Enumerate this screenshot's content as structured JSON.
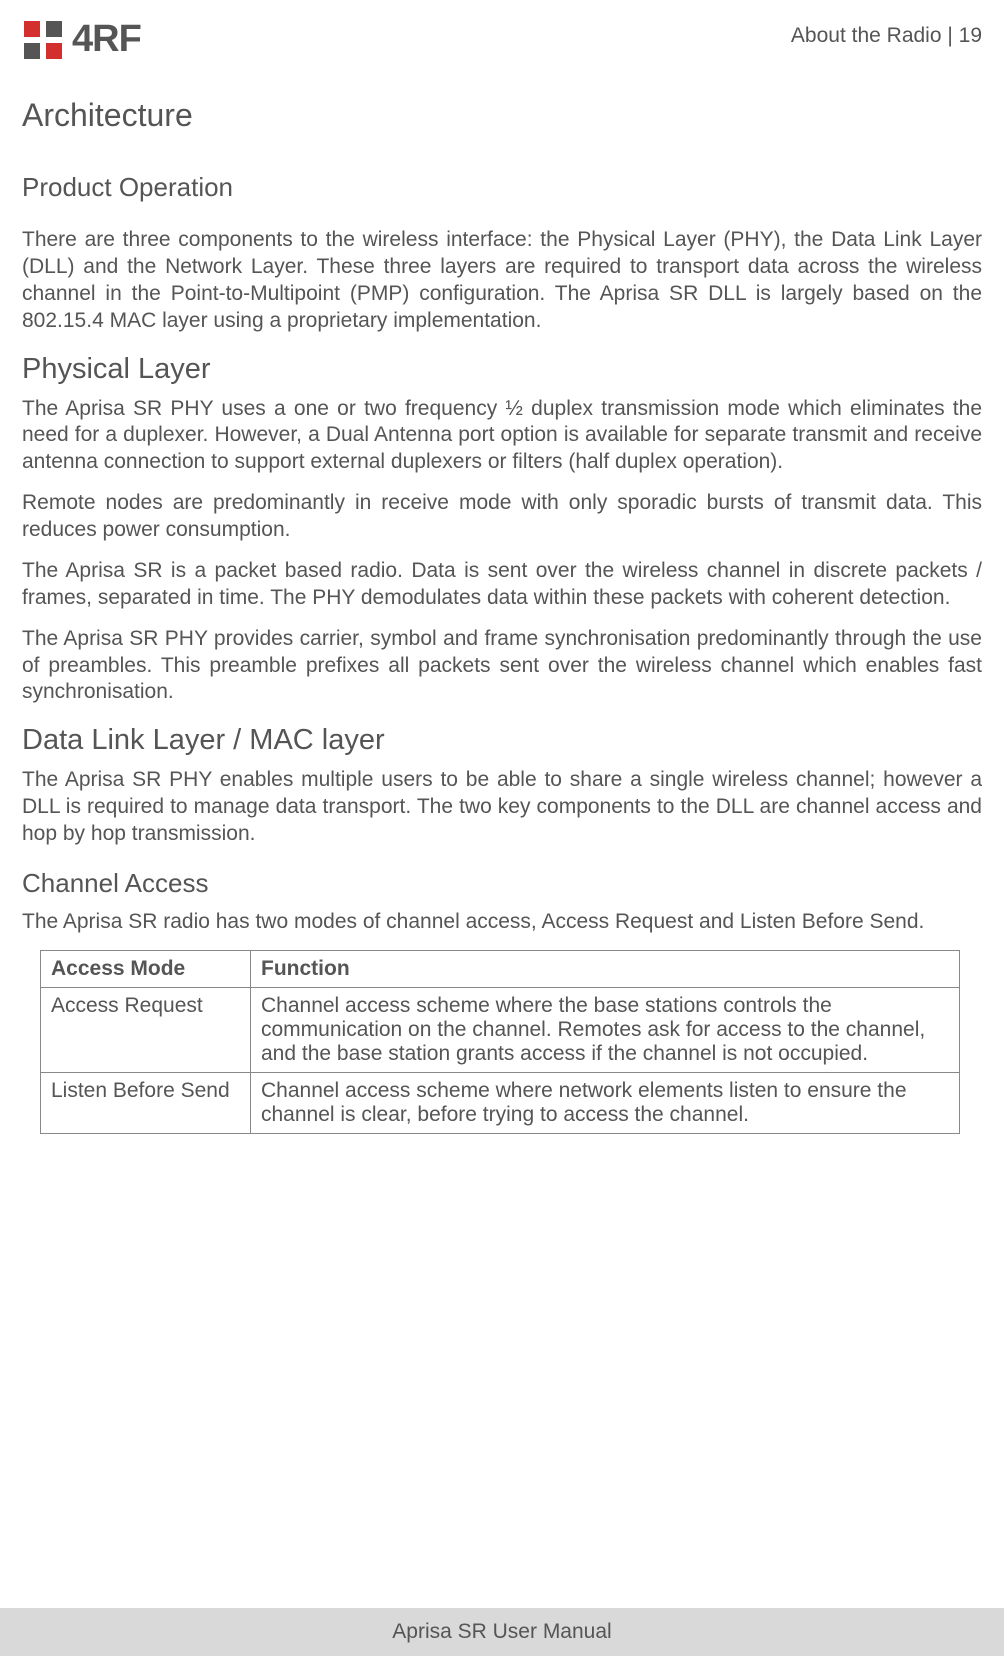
{
  "header": {
    "logo_text": "4RF",
    "section_label": "About the Radio  |  19"
  },
  "h1": "Architecture",
  "product_operation": {
    "heading": "Product Operation",
    "p1": "There are three components to the wireless interface: the Physical Layer (PHY), the Data Link Layer (DLL) and the Network Layer. These three layers are required to transport data across the wireless channel in the Point-to-Multipoint (PMP) configuration. The Aprisa SR DLL is largely based on the 802.15.4 MAC layer using a proprietary implementation."
  },
  "physical_layer": {
    "heading": "Physical Layer",
    "p1": "The Aprisa SR PHY uses a one or two frequency ½ duplex transmission mode which eliminates the need for a duplexer. However, a Dual Antenna port option is available for separate transmit and receive antenna connection to support external duplexers or filters (half duplex operation).",
    "p2": "Remote nodes are predominantly in receive mode with only sporadic bursts of transmit data. This reduces power consumption.",
    "p3": "The Aprisa SR is a packet based radio. Data is sent over the wireless channel in discrete packets / frames, separated in time. The PHY demodulates data within these packets with coherent detection.",
    "p4": "The Aprisa SR PHY provides carrier, symbol and frame synchronisation predominantly through the use of preambles. This preamble prefixes all packets sent over the wireless channel which enables fast synchronisation."
  },
  "dll": {
    "heading": "Data Link Layer / MAC layer",
    "p1": "The Aprisa SR PHY enables multiple users to be able to share a single wireless channel; however a DLL is required to manage data transport. The two key components to the DLL are channel access and hop by hop transmission."
  },
  "channel_access": {
    "heading": "Channel Access",
    "p1": "The Aprisa SR radio has two modes of channel access, Access Request and Listen Before Send.",
    "table": {
      "headers": {
        "mode": "Access Mode",
        "function": "Function"
      },
      "rows": [
        {
          "mode": "Access Request",
          "function": "Channel access scheme where the base stations controls the communication on the channel.  Remotes ask for access to the channel, and the base station grants access if the channel is not occupied."
        },
        {
          "mode": "Listen Before Send",
          "function": "Channel access scheme where network elements listen to ensure the channel is clear, before trying to access the channel."
        }
      ]
    }
  },
  "footer": "Aprisa SR User Manual"
}
